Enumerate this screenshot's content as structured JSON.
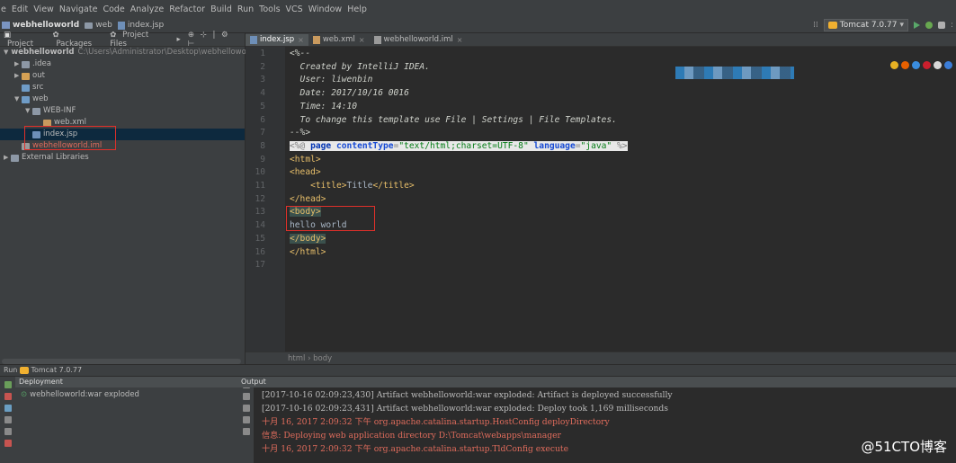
{
  "menu": [
    "e",
    "Edit",
    "View",
    "Navigate",
    "Code",
    "Analyze",
    "Refactor",
    "Build",
    "Run",
    "Tools",
    "VCS",
    "Window",
    "Help"
  ],
  "breadcrumbs": [
    "webhelloworld",
    "web",
    "index.jsp"
  ],
  "run_config": {
    "name": "Tomcat 7.0.77"
  },
  "project_panel": {
    "tabs": [
      "Project",
      "Packages",
      "Project Files"
    ],
    "tree": [
      {
        "label": "webhelloworld",
        "path": "C:\\Users\\Administrator\\Desktop\\webhelloworld",
        "depth": 0,
        "type": "module",
        "expanded": true
      },
      {
        "label": ".idea",
        "depth": 1,
        "type": "folder",
        "expanded": false
      },
      {
        "label": "out",
        "depth": 1,
        "type": "folder-orange",
        "expanded": false
      },
      {
        "label": "src",
        "depth": 1,
        "type": "folder-blue",
        "leaf": true
      },
      {
        "label": "web",
        "depth": 1,
        "type": "folder-blue",
        "expanded": true
      },
      {
        "label": "WEB-INF",
        "depth": 2,
        "type": "folder",
        "expanded": true
      },
      {
        "label": "web.xml",
        "depth": 3,
        "type": "xml",
        "leaf": true
      },
      {
        "label": "index.jsp",
        "depth": 2,
        "type": "jsp",
        "leaf": true,
        "selected": true
      },
      {
        "label": "webhelloworld.iml",
        "depth": 1,
        "type": "iml",
        "leaf": true,
        "red": true
      },
      {
        "label": "External Libraries",
        "depth": 0,
        "type": "lib",
        "expanded": false
      }
    ]
  },
  "editor": {
    "tabs": [
      {
        "label": "index.jsp",
        "active": true
      },
      {
        "label": "web.xml",
        "active": false
      },
      {
        "label": "webhelloworld.iml",
        "active": false
      }
    ],
    "line_numbers": [
      "1",
      "2",
      "3",
      "4",
      "5",
      "6",
      "7",
      "8",
      "9",
      "10",
      "11",
      "12",
      "13",
      "14",
      "15",
      "16",
      "17"
    ],
    "lines": {
      "l1": "<%--",
      "l2": "  Created by IntelliJ IDEA.",
      "l3": "  User: liwenbin",
      "l4": "  Date: 2017/10/16 0016",
      "l5": "  Time: 14:10",
      "l6": "  To change this template use File | Settings | File Templates.",
      "l7": "--%>",
      "l8_open": "<%@ ",
      "l8_kw": "page",
      "l8_a1": "contentType",
      "l8_eq1": "=",
      "l8_v1": "\"text/html;charset=UTF-8\"",
      "l8_a2": "language",
      "l8_eq2": "=",
      "l8_v2": "\"java\"",
      "l8_close": " %>",
      "l9": "<html>",
      "l10": "<head>",
      "l11_open": "<title>",
      "l11_text": "Title",
      "l11_close": "</title>",
      "l12": "</head>",
      "l13": "<body>",
      "l14": "hello world",
      "l15": "</body>",
      "l16": "</html>"
    },
    "breadcrumb": "html › body"
  },
  "run_panel": {
    "title": "Run",
    "config": "Tomcat 7.0.77",
    "deployment_label": "Deployment",
    "output_label": "Output",
    "deploy_item": "webhelloworld:war exploded",
    "output_lines": [
      {
        "text": "[2017-10-16 02:09:23,430] Artifact webhelloworld:war exploded: Artifact is deployed successfully",
        "color": "white"
      },
      {
        "text": "[2017-10-16 02:09:23,431] Artifact webhelloworld:war exploded: Deploy took 1,169 milliseconds",
        "color": "white"
      },
      {
        "text": "十月 16, 2017 2:09:32 下午 org.apache.catalina.startup.HostConfig deployDirectory",
        "color": "red"
      },
      {
        "text": "信息: Deploying web application directory D:\\Tomcat\\webapps\\manager",
        "color": "red"
      },
      {
        "text": "十月 16, 2017 2:09:32 下午 org.apache.catalina.startup.TldConfig execute",
        "color": "red"
      }
    ]
  },
  "watermark": "@51CTO博客"
}
